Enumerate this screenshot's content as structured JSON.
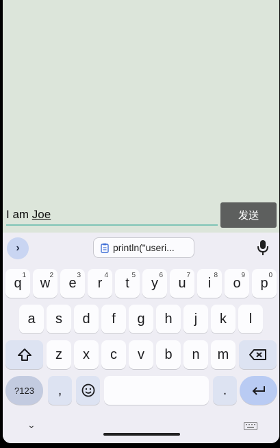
{
  "chat": {
    "input_typed": "I am ",
    "input_composing": "Joe",
    "send_label": "发送"
  },
  "keyboard": {
    "clipboard_chip": "println(\"useri...",
    "row1": [
      {
        "char": "q",
        "hint": "1"
      },
      {
        "char": "w",
        "hint": "2"
      },
      {
        "char": "e",
        "hint": "3"
      },
      {
        "char": "r",
        "hint": "4"
      },
      {
        "char": "t",
        "hint": "5"
      },
      {
        "char": "y",
        "hint": "6"
      },
      {
        "char": "u",
        "hint": "7"
      },
      {
        "char": "i",
        "hint": "8"
      },
      {
        "char": "o",
        "hint": "9"
      },
      {
        "char": "p",
        "hint": "0"
      }
    ],
    "row2": [
      "a",
      "s",
      "d",
      "f",
      "g",
      "h",
      "j",
      "k",
      "l"
    ],
    "row3": [
      "z",
      "x",
      "c",
      "v",
      "b",
      "n",
      "m"
    ],
    "symbols_label": "?123",
    "comma_label": ",",
    "period_label": ".",
    "icons": {
      "expand": "chevron-right-icon",
      "clipboard": "clipboard-icon",
      "mic": "microphone-icon",
      "shift": "shift-icon",
      "backspace": "backspace-icon",
      "emoji": "emoji-icon",
      "enter": "enter-icon",
      "hide": "chevron-down-icon",
      "switch": "keyboard-icon"
    }
  }
}
